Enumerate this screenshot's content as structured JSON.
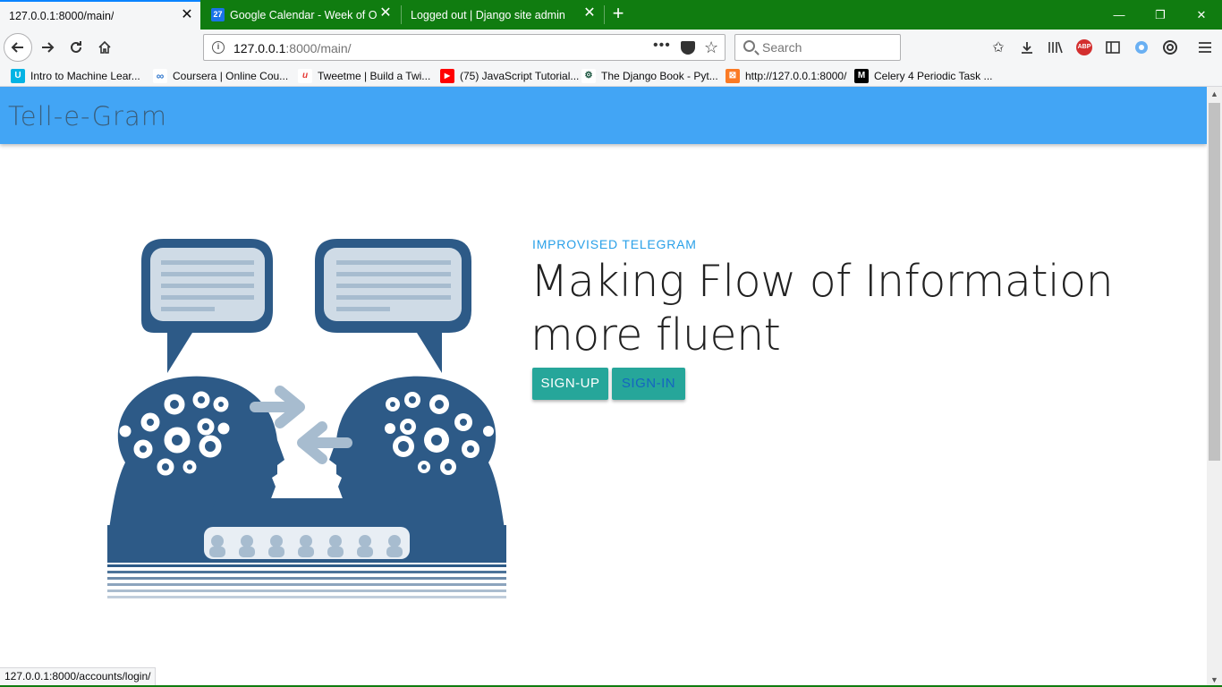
{
  "tabs": [
    {
      "title": "127.0.0.1:8000/main/",
      "active": true
    },
    {
      "title": "Google Calendar - Week of Oct",
      "favicon_text": "27",
      "active": false
    },
    {
      "title": "Logged out | Django site admin",
      "active": false
    }
  ],
  "window": {
    "accent_color": "#107c10"
  },
  "navbar": {
    "url_host": "127.0.0.1",
    "url_rest": ":8000/main/",
    "search_placeholder": "Search",
    "abp_label": "ABP"
  },
  "bookmarks": [
    {
      "label": "Intro to Machine Lear...",
      "icon": "udacity-icon"
    },
    {
      "label": "Coursera | Online Cou...",
      "icon": "coursera-icon"
    },
    {
      "label": "Tweetme | Build a Twi...",
      "icon": "tweetme-icon"
    },
    {
      "label": "(75) JavaScript Tutorial...",
      "icon": "youtube-icon"
    },
    {
      "label": "The Django Book - Pyt...",
      "icon": "django-book-icon"
    },
    {
      "label": "http://127.0.0.1:8000/",
      "icon": "xampp-icon"
    },
    {
      "label": "Celery 4 Periodic Task ...",
      "icon": "medium-icon"
    }
  ],
  "page": {
    "brand": "Tell-e-Gram",
    "kicker": "IMPROVISED TELEGRAM",
    "headline": "Making Flow of Information more fluent",
    "signup_label": "SIGN-UP",
    "signin_label": "SIGN-IN",
    "appbar_color": "#42a5f5",
    "button_color": "#26a69a"
  },
  "status_url": "127.0.0.1:8000/accounts/login/"
}
